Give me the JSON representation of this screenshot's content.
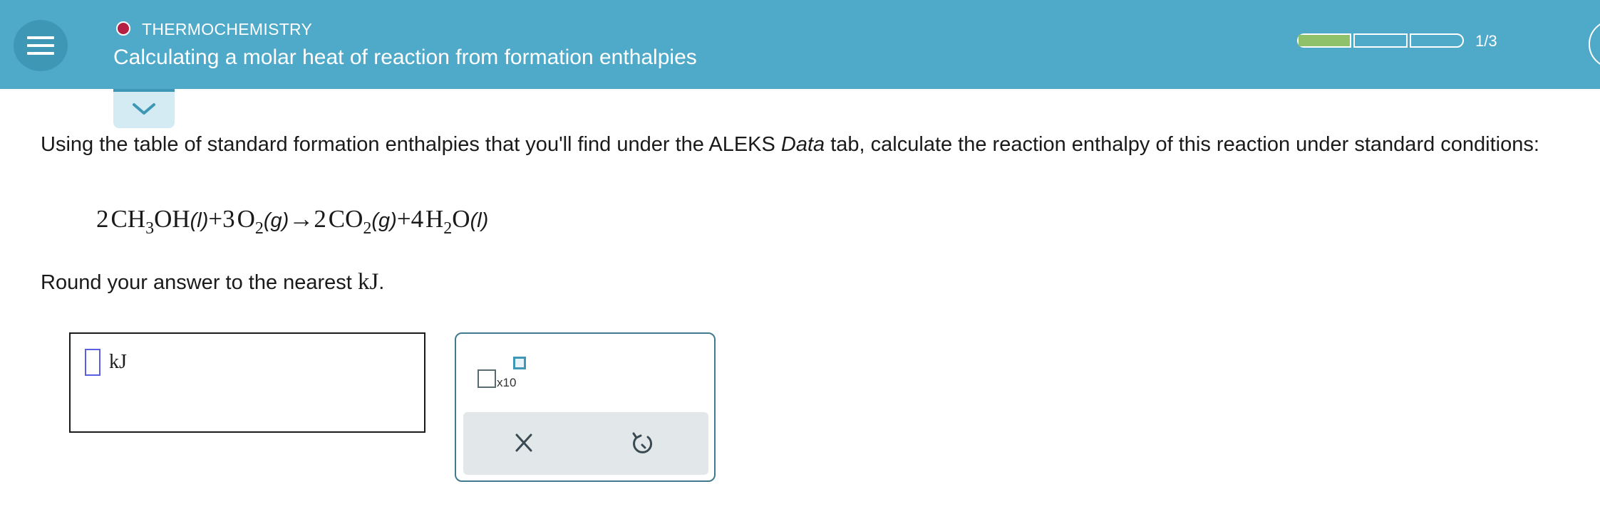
{
  "header": {
    "topic": "THERMOCHEMISTRY",
    "topic_color": "#b51f43",
    "title": "Calculating a molar heat of reaction from formation enthalpies",
    "bg_color": "#4fa9c8",
    "menu_icon": "hamburger-icon",
    "progress": {
      "segments": 3,
      "completed_fraction_of_first": 1.0,
      "fill_color": "#8fc16a",
      "label": "1/3"
    }
  },
  "collapse": {
    "icon": "chevron-down-icon"
  },
  "question": {
    "text_before": "Using the table of standard formation enthalpies that you'll find under the ALEKS ",
    "text_italic": "Data",
    "text_after": " tab, calculate the reaction enthalpy of this reaction under standard conditions:"
  },
  "equation": {
    "r1_coef": "2",
    "r1_formula_a": "CH",
    "r1_sub": "3",
    "r1_formula_b": "OH",
    "r1_state": "(l)",
    "plus1": "+",
    "r2_coef": "3",
    "r2_formula": "O",
    "r2_sub": "2",
    "r2_state": "(g)",
    "arrow": "→",
    "p1_coef": "2",
    "p1_formula": "CO",
    "p1_sub": "2",
    "p1_state": "(g)",
    "plus2": "+",
    "p2_coef": "4",
    "p2_formula_a": "H",
    "p2_sub": "2",
    "p2_formula_b": "O",
    "p2_state": "(l)"
  },
  "instruction": {
    "text": "Round your answer to the nearest ",
    "unit": "kJ",
    "period": "."
  },
  "answer": {
    "value": "",
    "unit": "kJ"
  },
  "tools": {
    "sci_label": "x10",
    "sci_icon": "scientific-notation-icon",
    "clear_icon": "close-icon",
    "undo_icon": "undo-icon"
  }
}
